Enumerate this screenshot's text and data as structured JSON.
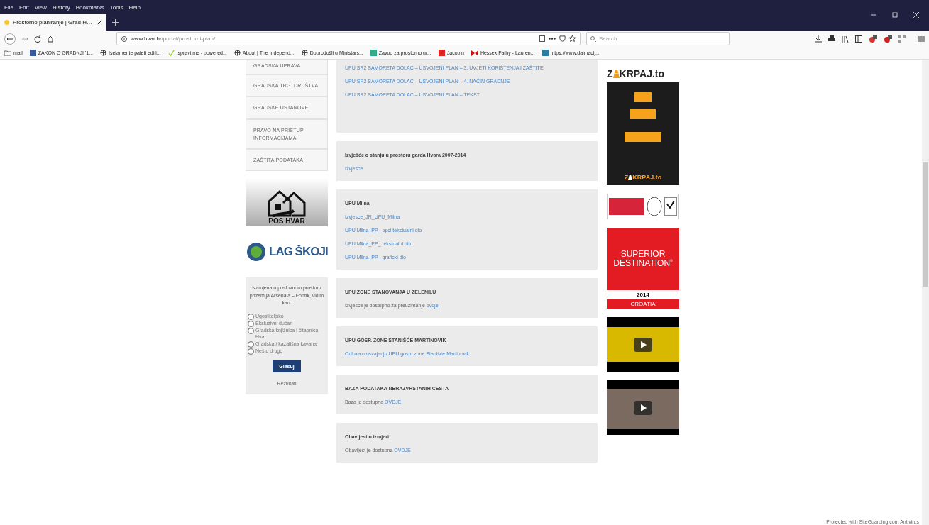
{
  "browser": {
    "menu": [
      "File",
      "Edit",
      "View",
      "History",
      "Bookmarks",
      "Tools",
      "Help"
    ],
    "tabs": [
      {
        "title": "Prostorno planiranje | Grad H…",
        "selected": true
      }
    ],
    "url": {
      "host": "www.hvar.hr",
      "path": "/portal/prostorni-plan/"
    },
    "search": {
      "placeholder": "Search"
    },
    "bookmarks": [
      {
        "label": "mail",
        "kind": "folder"
      },
      {
        "label": "ZAKON O GRADNJI '1...",
        "kind": "facebook"
      },
      {
        "label": "Iselamente paieti edifi...",
        "kind": "globe"
      },
      {
        "label": "Ispravi.me - powered...",
        "kind": "check"
      },
      {
        "label": "About | The Independ...",
        "kind": "globe"
      },
      {
        "label": "Dobrodošli u Ministars...",
        "kind": "globe"
      },
      {
        "label": "Zavod za prostorno ur...",
        "kind": "map"
      },
      {
        "label": "Jacobin",
        "kind": "red"
      },
      {
        "label": "Hessex Fathy - Lauren...",
        "kind": "bow"
      },
      {
        "label": "https://www.dalmacij...",
        "kind": "doc"
      }
    ]
  },
  "sidebar": {
    "nav_items": [
      "GRADSKA UPRAVA",
      "GRADSKA TRG. DRUŠTVA",
      "GRADSKE USTANOVE",
      "PRAVO NA PRISTUP INFORMACIJAMA",
      "ZAŠTITA PODATAKA"
    ],
    "pos_banner": "POS HVAR",
    "lag_logo": {
      "name": "LAG ŠKOJI"
    },
    "poll": {
      "question": "Namjena u poslovnom prostoru prizemlja Arsenala – Fontik, vidim kao:",
      "options": [
        {
          "label": "Ugostiteljsko",
          "selected": false
        },
        {
          "label": "Eksluzivni dućan",
          "selected": false
        },
        {
          "label": "Gradska knjižnica i čitaonica Hvar",
          "selected": false
        },
        {
          "label": "Gradska / kazališna kavana",
          "selected": false
        },
        {
          "label": "Nešto drugo",
          "selected": false
        }
      ],
      "button": "Glasuj",
      "results": "Rezultati"
    }
  },
  "cards": [
    {
      "items": [
        {
          "link": "UPU SR2 SAMORETA DOLAC – USVOJENI PLAN – 3. UVJETI KORIŠTENJA I ZAŠTITE"
        },
        {
          "link": "UPU SR2 SAMORETA DOLAC – USVOJENI PLAN – 4. NAČIN GRADNJE"
        },
        {
          "link": "UPU SR2 SAMORETA DOLAC – USVOJENI PLAN – TEKST"
        }
      ]
    },
    {
      "title": "Izvješće o stanju u prostoru garda Hvara 2007-2014",
      "items": [
        {
          "link": "Izvjesce"
        }
      ]
    },
    {
      "title": "UPU Milna",
      "items": [
        {
          "link": "Izvjesce_JR_UPU_Milna"
        },
        {
          "link": "UPU Milna_PP_ opci tekstualni dio"
        },
        {
          "link": "UPU Milna_PP_ tekstualni dio"
        },
        {
          "link": "UPU Milna_PP_ graficki dio"
        }
      ]
    },
    {
      "title": "UPU ZONE STANOVANJA U ZELENILU",
      "items": [
        {
          "text": "Izvješće je dostupno za preuzimanje ",
          "link": "ovdje."
        }
      ]
    },
    {
      "title": "UPU GOSP. ZONE STANIŠĆE MARTINOVIK",
      "items": [
        {
          "link": "Odluka o usvajanju UPU gosp. zone Stanišće Martinovik"
        }
      ]
    },
    {
      "title": "BAZA PODATAKA NERAZVRSTANIH CESTA",
      "items": [
        {
          "text": "Baza je dostupna ",
          "link": "OVDJE"
        }
      ]
    },
    {
      "title": "Obavijest o izmjeri",
      "items": [
        {
          "text": "Obavijest je dostupna ",
          "link": "OVDJE"
        }
      ]
    }
  ],
  "right": {
    "zakrpaj": {
      "before": "Z",
      "after": "KRPAJ.to"
    },
    "zakrpaj_poster": {
      "before": "Z",
      "after": "KRPAJ.to"
    },
    "superior": {
      "line_1": "SUPERIOR",
      "line_2": "DESTINATION",
      "mark": "®",
      "year": "2014",
      "country": "CROATIA"
    }
  },
  "footer": "Protected with SiteGuarding.com Antivirus"
}
